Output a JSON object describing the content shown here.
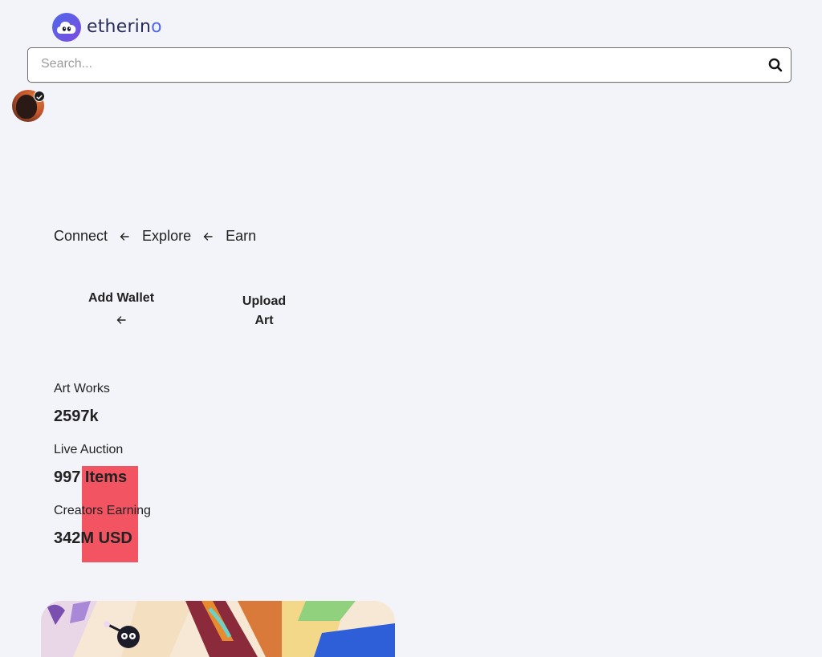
{
  "brand": {
    "name_main": "etherin",
    "name_accent": "o",
    "accent_color": "#4f68e9"
  },
  "search": {
    "placeholder": "Search...",
    "icon": "search-icon"
  },
  "avatar": {
    "badge_icon": "verified-check-icon"
  },
  "steps": [
    {
      "label": "Connect"
    },
    {
      "label": "Explore"
    },
    {
      "label": "Earn"
    }
  ],
  "actions": {
    "add_wallet": "Add Wallet",
    "upload_art_line1": "Upload",
    "upload_art_line2": "Art"
  },
  "stats": [
    {
      "label": "Art Works",
      "value": "2597k"
    },
    {
      "label": "Live Auction",
      "value": "997 Items"
    },
    {
      "label": "Creators Earning",
      "value": "342M USD"
    }
  ],
  "colors": {
    "background": "#f3f4f9",
    "highlight_block": "#f25461"
  }
}
